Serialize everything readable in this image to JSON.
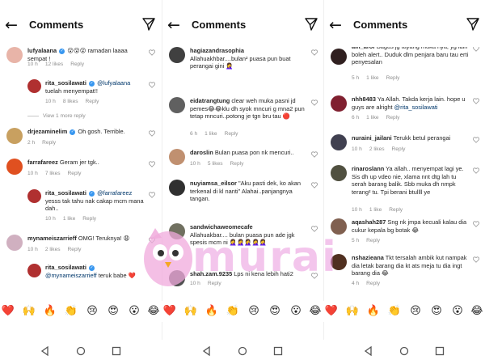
{
  "panels": [
    {
      "title": "Comments",
      "comments": [
        {
          "user": "lufyalaana",
          "verified": true,
          "text": "😮😮😮 ramadan laaaa sempat !",
          "time": "10 h",
          "likes": "12 likes",
          "reply": "Reply",
          "av_color": "#e8b4a8"
        },
        {
          "user": "rita_sosilawati",
          "verified": true,
          "mention": "@lufyalaana",
          "text": "tuelah menyempat!!",
          "time": "10 h",
          "likes": "8 likes",
          "reply": "Reply",
          "av_color": "#b03030"
        },
        {
          "view_more": "View 1 more reply"
        },
        {
          "user": "drjezaminelim",
          "verified": true,
          "text": "Oh gosh. Terrible.",
          "time": "2 h",
          "likes": "",
          "reply": "Reply",
          "av_color": "#c8a060"
        },
        {
          "user": "farrafareez",
          "verified": false,
          "text": "Geram jer tgk..",
          "time": "10 h",
          "likes": "7 likes",
          "reply": "Reply",
          "av_color": "#e05020"
        },
        {
          "user": "rita_sosilawati",
          "verified": true,
          "mention": "@farrafareez",
          "text": "yesss tak tahu nak cakap mcm mana dah..",
          "time": "10 h",
          "likes": "1 like",
          "reply": "Reply",
          "av_color": "#b03030"
        },
        {
          "user": "mynameiszarrieff",
          "verified": false,
          "text": "OMG! Teruknya! 😩",
          "time": "10 h",
          "likes": "2 likes",
          "reply": "Reply",
          "av_color": "#d0b0c0"
        },
        {
          "user": "rita_sosilawati",
          "verified": true,
          "mention": "@mynameiszarrieff",
          "text": "teruk babe ❤️",
          "time": "",
          "likes": "",
          "reply": "",
          "av_color": "#b03030"
        }
      ]
    },
    {
      "title": "Comments",
      "comments": [
        {
          "user": "hagiazandrasophia",
          "text": "Allahuakhbar....bulan² puasa pun buat perangai gini 🤦‍♀️",
          "time": "",
          "likes": "",
          "reply": "",
          "av_color": "#404040"
        },
        {
          "user": "eidatrangtung",
          "text": "clear weh muka pasni jd pemes😂😂klu dh syok mncuri g mna2 pun tetap mncuri..potong je tgn bru tau 🔴",
          "time": "6 h",
          "likes": "1 like",
          "reply": "Reply",
          "av_color": "#606060"
        },
        {
          "user": "daroslin",
          "text": "Bulan puasa pon nk mencuri..",
          "time": "10 h",
          "likes": "5 likes",
          "reply": "Reply",
          "av_color": "#c09070"
        },
        {
          "user": "nuyiamsa_eilsor",
          "text": "\"Aku pasti dek, ko akan terkenal di kl nanti\" Alahai..panjangnya tangan.",
          "time": "",
          "likes": "",
          "reply": "",
          "av_color": "#303030"
        },
        {
          "user": "sandwichaweomecafe",
          "text": "Allahuakbar.... bulan puasa pun ade jgk spesis mcm ni 🤦‍♀️🤦‍♀️🤦‍♀️🤦‍♀️🤦‍♀️",
          "time": "",
          "likes": "",
          "reply": "",
          "av_color": "#707060"
        },
        {
          "user": "shah.zam.9235",
          "text": "Lps ni kena lebih hati2",
          "time": "10 h",
          "likes": "",
          "reply": "Reply",
          "av_color": "#505050"
        }
      ]
    },
    {
      "title": "Comments",
      "comments": [
        {
          "user": "ain_arof",
          "text": "Bagus jg tayang muka nya, yg lain boleh alert.. Duduk dlm penjara baru tau erti penyesalan",
          "time": "5 h",
          "likes": "1 like",
          "reply": "Reply",
          "av_color": "#302020"
        },
        {
          "user": "nhh8483",
          "text": "Ya Allah. Takda kerja lain. hope u guys are alright",
          "mention": "@rita_sosilawati",
          "time": "6 h",
          "likes": "1 like",
          "reply": "Reply",
          "av_color": "#802030"
        },
        {
          "user": "nuraini_jailani",
          "text": "Terukk betul perangai",
          "time": "10 h",
          "likes": "2 likes",
          "reply": "Reply",
          "av_color": "#404050"
        },
        {
          "user": "rinaroslann",
          "text": "Ya allah.. menyempat lagi ye. Sis dh up vdeo nie, xlama nnt dtg lah tu serah barang balik. Sbb muka dh nmpk terang² tu. Tpi berani btullll ye",
          "time": "10 h",
          "likes": "1 like",
          "reply": "Reply",
          "av_color": "#505040"
        },
        {
          "user": "aqashah287",
          "text": "Sng nk jmpa kecuali kalau dia cukur kepala bg botak 😂",
          "time": "5 h",
          "likes": "",
          "reply": "Reply",
          "av_color": "#806050"
        },
        {
          "user": "nshazieana",
          "text": "Tkt tersalah ambik kut nampak dia letak barang dia kt ats meja tu dia ingt barang dia 😂",
          "time": "4 h",
          "likes": "",
          "reply": "Reply",
          "av_color": "#503020"
        }
      ]
    }
  ],
  "emoji_bar": [
    "❤️",
    "🙌",
    "🔥",
    "👏",
    "😢",
    "😍",
    "😮",
    "😂",
    "❤️",
    "🙌",
    "🔥",
    "👏",
    "😢",
    "😍",
    "😮",
    "😂",
    "❤️",
    "🙌",
    "🔥",
    "👏",
    "😢",
    "😍",
    "😮",
    "😂"
  ],
  "watermark": {
    "text": "murai"
  }
}
